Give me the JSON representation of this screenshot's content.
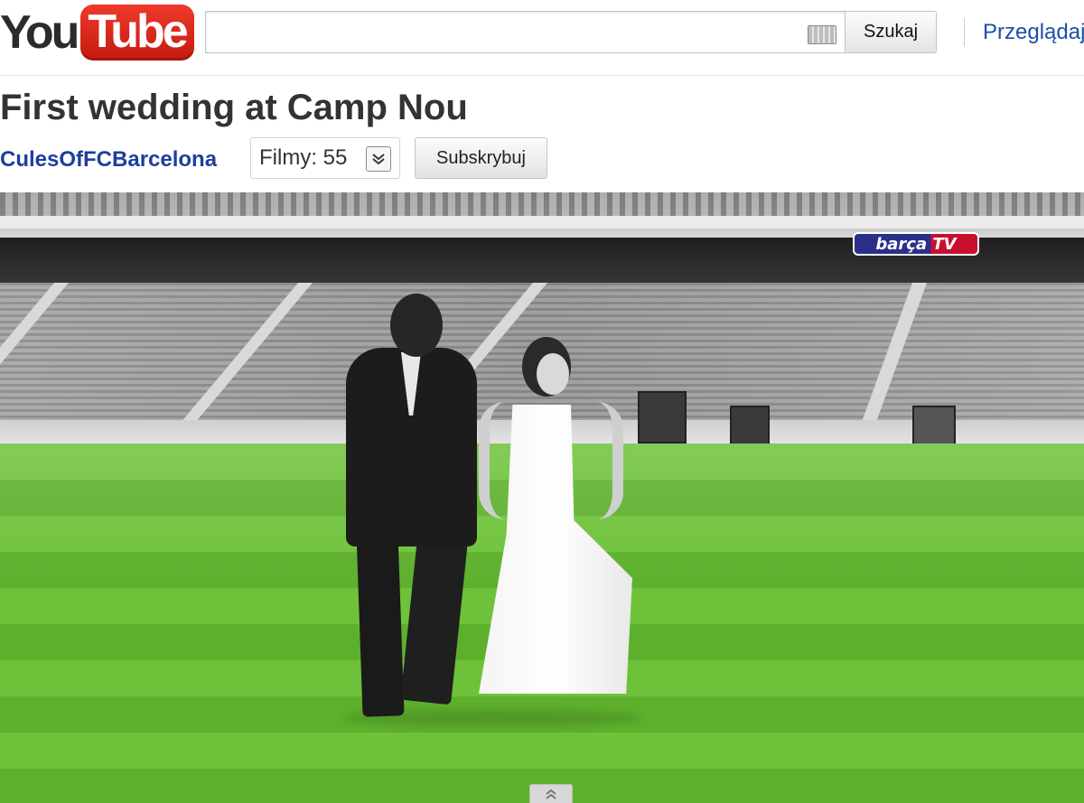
{
  "header": {
    "logo": {
      "part1": "You",
      "part2": "Tube"
    },
    "search": {
      "value": "",
      "placeholder": "",
      "button_label": "Szukaj"
    },
    "browse_link": "Przeglądaj"
  },
  "video": {
    "title": "First wedding at Camp Nou",
    "channel": "CulesOfFCBarcelona",
    "videos_count_label": "Filmy: 55",
    "subscribe_label": "Subskrybuj",
    "watermark": "barça TV"
  },
  "icons": {
    "keyboard": "keyboard-icon",
    "chevron": "double-chevron-down-icon",
    "expand": "double-chevron-up-icon"
  }
}
